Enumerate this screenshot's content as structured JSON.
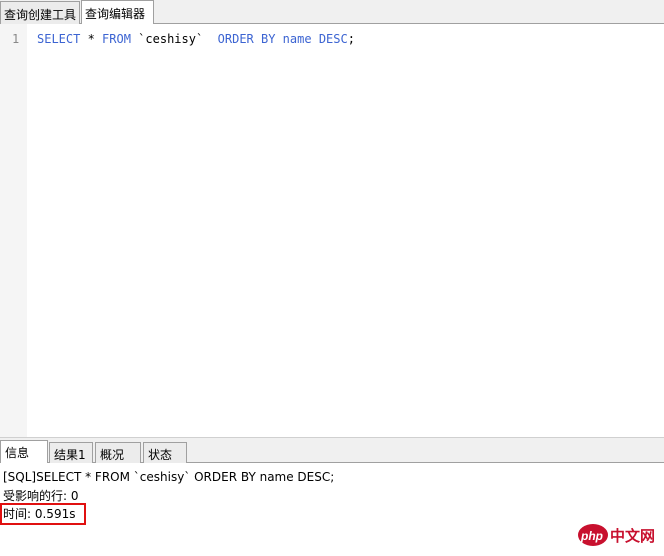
{
  "top_tabs": [
    "查询创建工具",
    "查询编辑器"
  ],
  "editor": {
    "line_number": "1",
    "kw_select": "SELECT",
    "star": " * ",
    "kw_from": "FROM",
    "table": " `ceshisy`  ",
    "kw_order_by": "ORDER BY",
    "name_col": " name ",
    "kw_desc": "DESC",
    "semicolon": ";"
  },
  "result_tabs": [
    "信息",
    "结果1",
    "概况",
    "状态"
  ],
  "info": {
    "sql_line": "[SQL]SELECT * FROM `ceshisy`  ORDER BY name DESC;",
    "affected_rows": "受影响的行: 0",
    "time": "时间: 0.591s"
  },
  "watermark": {
    "logo": "php",
    "text": "中文网"
  },
  "colors": {
    "keyword": "#3c64d2",
    "highlight": "#e01010",
    "watermark": "#c8102e"
  }
}
